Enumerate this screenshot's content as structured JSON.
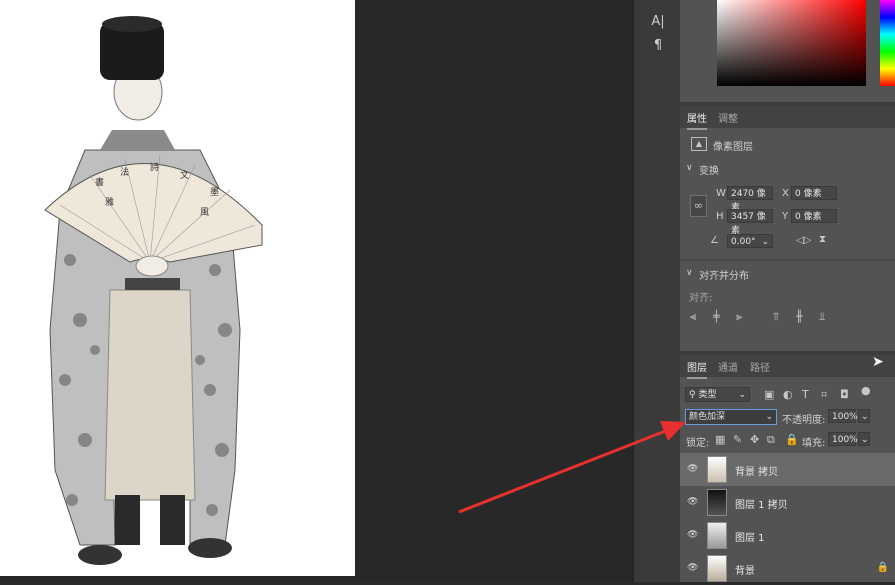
{
  "tools": {
    "char_icon": "A|",
    "para_icon": "¶"
  },
  "properties": {
    "tabs": [
      "属性",
      "调整"
    ],
    "layer_type": "像素图层",
    "transform_title": "变换",
    "w_label": "W",
    "w_value": "2470 像素",
    "h_label": "H",
    "h_value": "3457 像素",
    "x_label": "X",
    "x_value": "0 像素",
    "y_label": "Y",
    "y_value": "0 像素",
    "angle_value": "0.00°",
    "align_title": "对齐并分布",
    "align_label": "对齐:"
  },
  "layers_panel": {
    "tabs": [
      "图层",
      "通道",
      "路径"
    ],
    "filter_kind": "类型",
    "blend_mode": "颜色加深",
    "opacity_label": "不透明度:",
    "opacity_value": "100%",
    "lock_label": "锁定:",
    "fill_label": "填充:",
    "fill_value": "100%",
    "layers": [
      {
        "name": "背景 拷贝",
        "active": true
      },
      {
        "name": "图层 1 拷贝",
        "active": false
      },
      {
        "name": "图层 1",
        "active": false
      },
      {
        "name": "背景",
        "active": false,
        "locked": true
      }
    ]
  },
  "colors": {
    "annotation_arrow": "#e8312f",
    "panel_bg": "#535353"
  }
}
